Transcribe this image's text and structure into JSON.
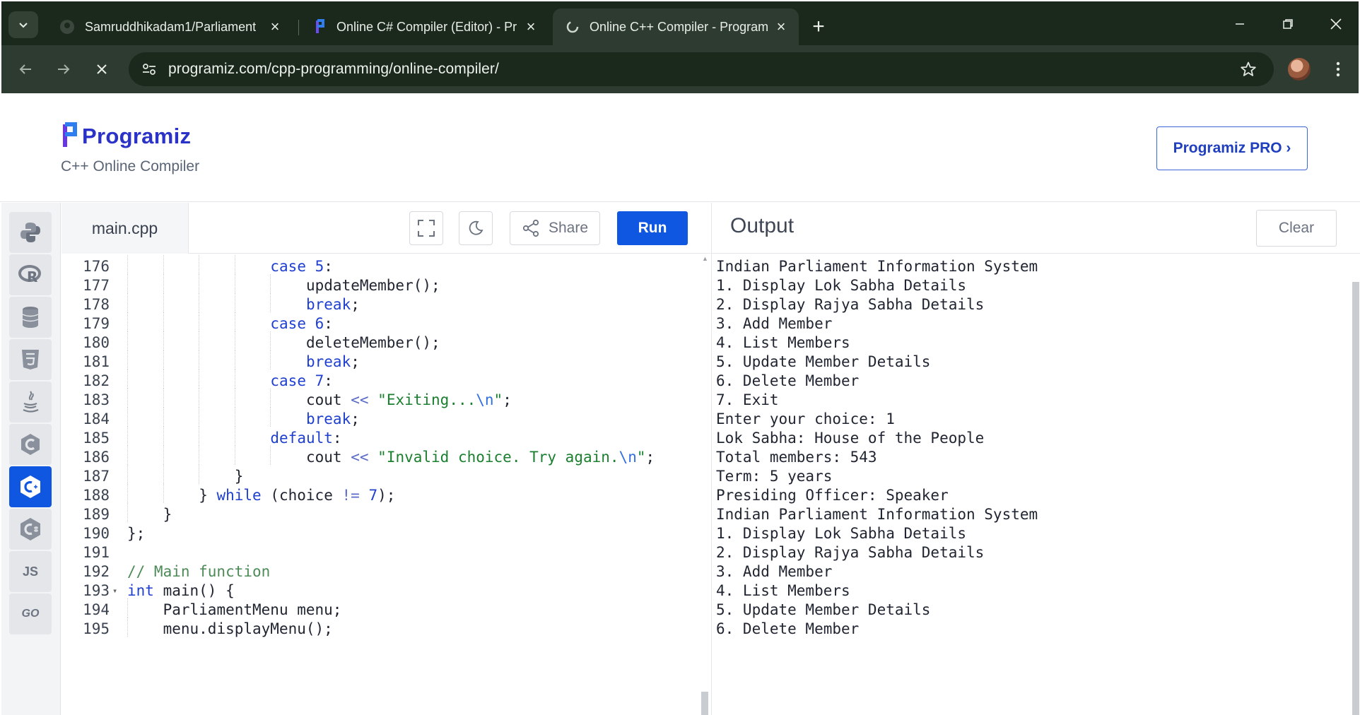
{
  "browser": {
    "tabs": [
      {
        "title": "Samruddhikadam1/Parliament",
        "icon": "github-icon"
      },
      {
        "title": "Online C# Compiler (Editor) - Pr",
        "icon": "programiz-icon"
      },
      {
        "title": "Online C++ Compiler - Program",
        "icon": "loading-icon"
      }
    ],
    "url": "programiz.com/cpp-programming/online-compiler/"
  },
  "header": {
    "logo": "Programiz",
    "subtitle": "C++ Online Compiler",
    "pro_button": "Programiz PRO ›"
  },
  "sidebar": {
    "languages": [
      {
        "name": "Python",
        "icon": "python-icon"
      },
      {
        "name": "R",
        "icon": "r-icon"
      },
      {
        "name": "SQL",
        "icon": "database-icon"
      },
      {
        "name": "HTML",
        "icon": "html5-icon"
      },
      {
        "name": "Java",
        "icon": "java-icon"
      },
      {
        "name": "C",
        "icon": "c-icon"
      },
      {
        "name": "C++",
        "icon": "cpp-icon",
        "active": true
      },
      {
        "name": "C#",
        "icon": "csharp-icon"
      },
      {
        "name": "JS",
        "icon": "js-icon",
        "label": "JS"
      },
      {
        "name": "Go",
        "icon": "go-icon",
        "label": "GO"
      }
    ]
  },
  "editor": {
    "filename": "main.cpp",
    "share_label": "Share",
    "run_label": "Run",
    "lines": [
      {
        "n": "176",
        "indent": 4,
        "tokens": [
          [
            "kw",
            "case "
          ],
          [
            "num",
            "5"
          ],
          [
            "p",
            ":"
          ]
        ]
      },
      {
        "n": "177",
        "indent": 5,
        "tokens": [
          [
            "p",
            "updateMember();"
          ]
        ]
      },
      {
        "n": "178",
        "indent": 5,
        "tokens": [
          [
            "kw",
            "break"
          ],
          [
            "p",
            ";"
          ]
        ]
      },
      {
        "n": "179",
        "indent": 4,
        "tokens": [
          [
            "kw",
            "case "
          ],
          [
            "num",
            "6"
          ],
          [
            "p",
            ":"
          ]
        ]
      },
      {
        "n": "180",
        "indent": 5,
        "tokens": [
          [
            "p",
            "deleteMember();"
          ]
        ]
      },
      {
        "n": "181",
        "indent": 5,
        "tokens": [
          [
            "kw",
            "break"
          ],
          [
            "p",
            ";"
          ]
        ]
      },
      {
        "n": "182",
        "indent": 4,
        "tokens": [
          [
            "kw",
            "case "
          ],
          [
            "num",
            "7"
          ],
          [
            "p",
            ":"
          ]
        ]
      },
      {
        "n": "183",
        "indent": 5,
        "tokens": [
          [
            "p",
            "cout "
          ],
          [
            "op",
            "<<"
          ],
          [
            "p",
            " "
          ],
          [
            "str",
            "\"Exiting..."
          ],
          [
            "esc",
            "\\n"
          ],
          [
            "str",
            "\""
          ],
          [
            "p",
            ";"
          ]
        ]
      },
      {
        "n": "184",
        "indent": 5,
        "tokens": [
          [
            "kw",
            "break"
          ],
          [
            "p",
            ";"
          ]
        ]
      },
      {
        "n": "185",
        "indent": 4,
        "tokens": [
          [
            "kw",
            "default"
          ],
          [
            "p",
            ":"
          ]
        ]
      },
      {
        "n": "186",
        "indent": 5,
        "tokens": [
          [
            "p",
            "cout "
          ],
          [
            "op",
            "<<"
          ],
          [
            "p",
            " "
          ],
          [
            "str",
            "\"Invalid choice. Try again."
          ],
          [
            "esc",
            "\\n"
          ],
          [
            "str",
            "\""
          ],
          [
            "p",
            ";"
          ]
        ]
      },
      {
        "n": "187",
        "indent": 3,
        "tokens": [
          [
            "p",
            "}"
          ]
        ]
      },
      {
        "n": "188",
        "indent": 2,
        "tokens": [
          [
            "p",
            "} "
          ],
          [
            "kw",
            "while"
          ],
          [
            "p",
            " (choice "
          ],
          [
            "op",
            "!="
          ],
          [
            "p",
            " "
          ],
          [
            "num",
            "7"
          ],
          [
            "p",
            ");"
          ]
        ]
      },
      {
        "n": "189",
        "indent": 1,
        "tokens": [
          [
            "p",
            "}"
          ]
        ]
      },
      {
        "n": "190",
        "indent": 0,
        "tokens": [
          [
            "p",
            "};"
          ]
        ]
      },
      {
        "n": "191",
        "indent": 0,
        "tokens": []
      },
      {
        "n": "192",
        "indent": 0,
        "tokens": [
          [
            "cm",
            "// Main function"
          ]
        ]
      },
      {
        "n": "193",
        "indent": 0,
        "fold": true,
        "tokens": [
          [
            "kw",
            "int"
          ],
          [
            "p",
            " main() {"
          ]
        ]
      },
      {
        "n": "194",
        "indent": 1,
        "tokens": [
          [
            "p",
            "ParliamentMenu menu;"
          ]
        ]
      },
      {
        "n": "195",
        "indent": 1,
        "tokens": [
          [
            "p",
            "menu.displayMenu();"
          ]
        ]
      }
    ]
  },
  "output": {
    "title": "Output",
    "clear_label": "Clear",
    "lines": [
      "Indian Parliament Information System",
      "1. Display Lok Sabha Details",
      "2. Display Rajya Sabha Details",
      "3. Add Member",
      "4. List Members",
      "5. Update Member Details",
      "6. Delete Member",
      "7. Exit",
      "Enter your choice: 1",
      "Lok Sabha: House of the People",
      "Total members: 543",
      "Term: 5 years",
      "Presiding Officer: Speaker",
      "Indian Parliament Information System",
      "1. Display Lok Sabha Details",
      "2. Display Rajya Sabha Details",
      "3. Add Member",
      "4. List Members",
      "5. Update Member Details",
      "6. Delete Member"
    ]
  },
  "colors": {
    "accent": "#0f56e0",
    "brand": "#2a32c7",
    "chrome_bg": "#1b281c",
    "keyword": "#1f3fd0",
    "string": "#1a7f2e"
  }
}
